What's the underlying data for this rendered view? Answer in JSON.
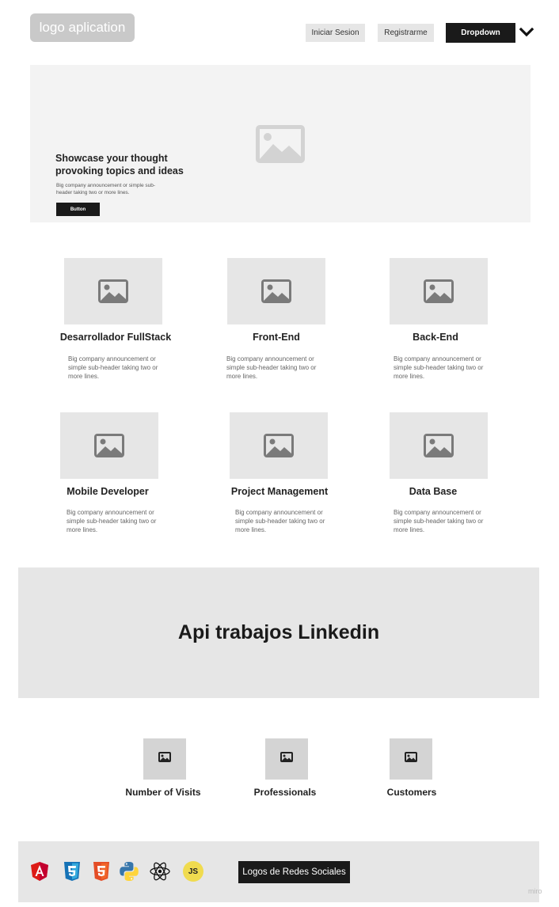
{
  "header": {
    "logo_text": "logo aplication",
    "login_label": "Iniciar Sesion",
    "register_label": "Registrarme",
    "dropdown_label": "Dropdown"
  },
  "hero": {
    "title": "Showcase your thought provoking topics and ideas",
    "subtitle": "Big company announcement or simple sub-header taking two or more lines.",
    "button_label": "Button"
  },
  "cards": [
    {
      "title": "Desarrollador FullStack",
      "desc": "Big company announcement or simple sub-header taking two or more lines."
    },
    {
      "title": "Front-End",
      "desc": "Big company announcement or simple sub-header taking two or more lines."
    },
    {
      "title": "Back-End",
      "desc": "Big company announcement or simple sub-header taking two or more lines."
    },
    {
      "title": "Mobile Developer",
      "desc": "Big company announcement or simple sub-header taking two or more lines."
    },
    {
      "title": "Project Management",
      "desc": "Big company announcement or simple sub-header taking two or more lines."
    },
    {
      "title": "Data Base",
      "desc": "Big company announcement or simple sub-header taking two or more lines."
    }
  ],
  "api_banner": {
    "title": "Api trabajos Linkedin"
  },
  "stats": [
    {
      "label": "Number of Visits"
    },
    {
      "label": "Professionals"
    },
    {
      "label": "Customers"
    }
  ],
  "footer": {
    "tech_icons": [
      "angular-icon",
      "css3-icon",
      "html5-icon",
      "python-icon",
      "react-icon",
      "javascript-icon"
    ],
    "js_badge_text": "JS",
    "social_button_label": "Logos de Redes Sociales",
    "watermark": "miro"
  },
  "colors": {
    "dark": "#1a1a1a",
    "placeholder_gray": "#e6e6e6",
    "hero_bg": "#f3f3f3",
    "angular_red": "#dd1b16",
    "css_blue": "#1572b6",
    "html_orange": "#e44d26",
    "js_yellow": "#f0db4f"
  }
}
